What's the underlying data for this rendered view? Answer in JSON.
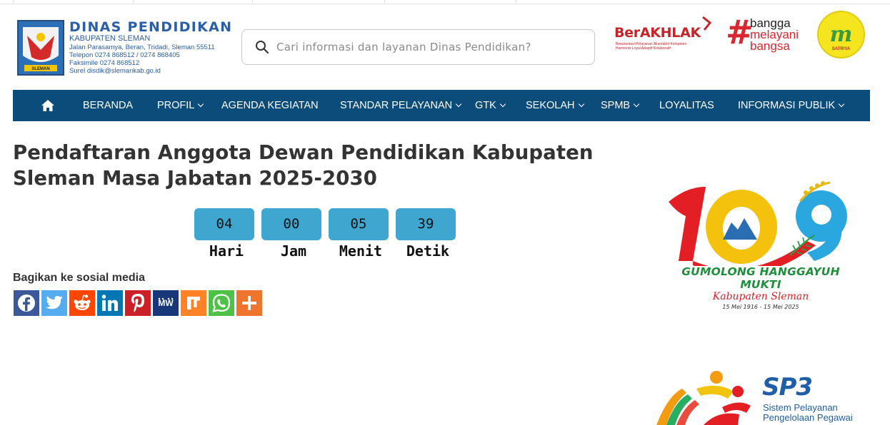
{
  "header": {
    "title": "DINAS PENDIDIKAN",
    "subtitle": "KABUPATEN SLEMAN",
    "address": "Jalan Parasamya, Beran, Tridadi, Sleman 55511",
    "phone": "Telepon 0274 868512 / 0274 868405",
    "fax": "Faksimile 0274 868512",
    "email": "Surel disdik@slemankab.go.id",
    "logo_label": "SLEMAN"
  },
  "search": {
    "placeholder": "Cari informasi dan layanan Dinas Pendidikan?",
    "icon": "search-icon"
  },
  "badges": {
    "berakhlak_title": "BerAKHLAK",
    "berakhlak_line1": "Berorientasi Pelayanan Akuntabel Kompeten",
    "berakhlak_line2": "Harmonis Loyal Adaptif Kolaboratif",
    "bangga_line1": "bangga",
    "bangga_line2": "melayani",
    "bangga_line3": "bangsa",
    "satriya_label": "SATRIYA"
  },
  "nav": {
    "home_icon": "home-icon",
    "items": [
      {
        "label": "BERANDA",
        "dropdown": false
      },
      {
        "label": "PROFIL",
        "dropdown": true
      },
      {
        "label": "AGENDA KEGIATAN",
        "dropdown": false
      },
      {
        "label": "STANDAR PELAYANAN",
        "dropdown": true
      },
      {
        "label": "GTK",
        "dropdown": true
      },
      {
        "label": "SEKOLAH",
        "dropdown": true
      },
      {
        "label": "SPMB",
        "dropdown": true
      },
      {
        "label": "LOYALITAS",
        "dropdown": false
      },
      {
        "label": "INFORMASI PUBLIK",
        "dropdown": true
      }
    ]
  },
  "article": {
    "title": "Pendaftaran Anggota Dewan Pendidikan Kabupaten Sleman Masa Jabatan 2025-2030"
  },
  "countdown": [
    {
      "value": "04",
      "label": "Hari"
    },
    {
      "value": "00",
      "label": "Jam"
    },
    {
      "value": "05",
      "label": "Menit"
    },
    {
      "value": "39",
      "label": "Detik"
    }
  ],
  "share": {
    "title": "Bagikan ke sosial media",
    "buttons": [
      {
        "name": "facebook",
        "color": "#3b5998"
      },
      {
        "name": "twitter",
        "color": "#55acee"
      },
      {
        "name": "reddit",
        "color": "#ff4500"
      },
      {
        "name": "linkedin",
        "color": "#0077b5"
      },
      {
        "name": "pinterest",
        "color": "#cb2027"
      },
      {
        "name": "mewe",
        "color": "#17377a"
      },
      {
        "name": "mix",
        "color": "#ff8226"
      },
      {
        "name": "whatsapp",
        "color": "#4dc247"
      },
      {
        "name": "more",
        "color": "#f0742e"
      }
    ]
  },
  "anniversary": {
    "number": "109",
    "slogan": "GUMOLONG HANGGAYUH MUKTI",
    "region": "Kabupaten Sleman",
    "dates": "15 Mei 1916 - 15 Mei 2025"
  },
  "sp3": {
    "title": "SP3",
    "line1": "Sistem Pelayanan",
    "line2": "Pengelolaan Pegawai"
  },
  "colors": {
    "nav_bg": "#0c4c7a",
    "countdown_bg": "#3fa6cf",
    "brand_blue": "#2a5ea8"
  }
}
